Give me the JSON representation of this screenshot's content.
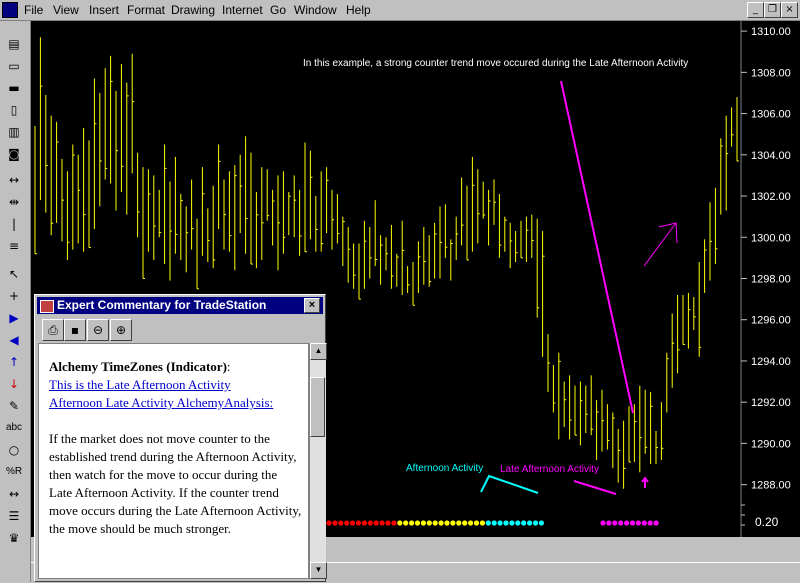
{
  "menu": {
    "items": [
      "File",
      "View",
      "Insert",
      "Format",
      "Drawing",
      "Internet",
      "Go",
      "Window",
      "Help"
    ]
  },
  "window_controls": {
    "minimize": "_",
    "restore": "❐",
    "close": "×"
  },
  "toolbar": {
    "icons": [
      "print-icon",
      "open-folder-icon",
      "save-folder-icon",
      "new-document-icon",
      "chart-icon",
      "strategy-icon",
      "expand-icon",
      "compress-icon",
      "vertical-line-icon",
      "horizontal-lines-icon",
      "pointer-icon",
      "crosshair-icon",
      "goto-end-icon",
      "goto-start-icon",
      "arrow-up-icon",
      "arrow-down-icon",
      "pencil-icon",
      "text-icon",
      "ellipse-icon",
      "percent-r-icon",
      "double-arrow-icon",
      "list-icon",
      "trophy-icon"
    ],
    "text_tool": "abc",
    "percent_tool": "%R"
  },
  "chart_data": {
    "type": "bar",
    "annotation_main": "In this example, a strong counter trend move occured during the Late Afternoon Activity",
    "label_afternoon": "Afternoon Activity",
    "label_late_afternoon": "Late Afternoon Activity",
    "y_ticks": [
      "1310.00",
      "1308.00",
      "1306.00",
      "1304.00",
      "1302.00",
      "1300.00",
      "1298.00",
      "1296.00",
      "1294.00",
      "1292.00",
      "1290.00",
      "1288.00"
    ],
    "y_tick_values": [
      1310,
      1308,
      1306,
      1304,
      1302,
      1300,
      1298,
      1296,
      1294,
      1292,
      1290,
      1288
    ],
    "ylim": [
      1287.4,
      1310.2
    ],
    "indicator_value": "0.20",
    "colors": {
      "price_bars": "#ffff00",
      "annotation": "#ff00ff",
      "afternoon": "#00ffff",
      "dot_red": "#ff0000",
      "dot_yellow": "#ffff00",
      "dot_cyan": "#00ffff",
      "dot_magenta": "#ff00ff"
    },
    "indicator_dots": {
      "red": 12,
      "yellow": 15,
      "cyan": 10,
      "magenta": 10
    },
    "price_bars": [
      [
        1305.4,
        1299.2
      ],
      [
        1309.7,
        1301.8
      ],
      [
        1306.9,
        1301.2
      ],
      [
        1305.9,
        1300.1
      ],
      [
        1305.6,
        1300.7
      ],
      [
        1303.8,
        1299.8
      ],
      [
        1303.2,
        1298.9
      ],
      [
        1304.5,
        1299.4
      ],
      [
        1304.0,
        1299.7
      ],
      [
        1305.3,
        1299.3
      ],
      [
        1304.7,
        1299.5
      ],
      [
        1307.7,
        1300.4
      ],
      [
        1307.0,
        1301.5
      ],
      [
        1308.2,
        1302.8
      ],
      [
        1308.8,
        1302.6
      ],
      [
        1307.1,
        1301.3
      ],
      [
        1308.4,
        1302.2
      ],
      [
        1307.5,
        1301.1
      ],
      [
        1308.9,
        1303.1
      ],
      [
        1304.1,
        1300.0
      ],
      [
        1303.4,
        1298.0
      ],
      [
        1303.3,
        1299.3
      ],
      [
        1303.0,
        1298.9
      ],
      [
        1302.3,
        1300.0
      ],
      [
        1304.5,
        1298.7
      ],
      [
        1302.7,
        1297.9
      ],
      [
        1303.9,
        1299.2
      ],
      [
        1302.1,
        1298.9
      ],
      [
        1301.5,
        1298.3
      ],
      [
        1302.8,
        1299.4
      ],
      [
        1300.9,
        1297.5
      ],
      [
        1303.4,
        1299.1
      ],
      [
        1301.4,
        1298.8
      ],
      [
        1302.5,
        1298.5
      ],
      [
        1304.5,
        1300.4
      ],
      [
        1302.8,
        1299.4
      ],
      [
        1303.2,
        1299.3
      ],
      [
        1303.5,
        1298.4
      ],
      [
        1304.0,
        1300.2
      ],
      [
        1304.9,
        1299.2
      ],
      [
        1304.1,
        1298.7
      ],
      [
        1302.2,
        1298.5
      ],
      [
        1303.4,
        1298.9
      ],
      [
        1303.3,
        1300.8
      ],
      [
        1302.3,
        1299.6
      ],
      [
        1303.0,
        1298.4
      ],
      [
        1303.2,
        1299.2
      ],
      [
        1302.2,
        1300.1
      ],
      [
        1303.0,
        1300.0
      ],
      [
        1302.3,
        1299.1
      ],
      [
        1304.6,
        1299.3
      ],
      [
        1304.2,
        1299.9
      ],
      [
        1302.0,
        1299.3
      ],
      [
        1303.2,
        1299.3
      ],
      [
        1303.4,
        1300.2
      ],
      [
        1302.3,
        1299.4
      ],
      [
        1302.1,
        1299.7
      ],
      [
        1301.0,
        1298.6
      ],
      [
        1300.5,
        1297.8
      ],
      [
        1299.7,
        1297.5
      ],
      [
        1299.7,
        1297.0
      ],
      [
        1300.8,
        1297.5
      ],
      [
        1300.5,
        1298.0
      ],
      [
        1301.8,
        1298.6
      ],
      [
        1300.1,
        1297.7
      ],
      [
        1300.0,
        1298.4
      ],
      [
        1300.6,
        1297.5
      ],
      [
        1299.2,
        1297.6
      ],
      [
        1300.8,
        1297.2
      ],
      [
        1298.6,
        1297.3
      ],
      [
        1298.8,
        1296.7
      ],
      [
        1299.8,
        1297.3
      ],
      [
        1300.5,
        1297.7
      ],
      [
        1300.1,
        1297.6
      ],
      [
        1300.7,
        1298.0
      ],
      [
        1301.5,
        1298.0
      ],
      [
        1301.6,
        1299.0
      ],
      [
        1299.9,
        1297.9
      ],
      [
        1301.0,
        1298.9
      ],
      [
        1302.9,
        1299.6
      ],
      [
        1302.5,
        1298.9
      ],
      [
        1303.9,
        1299.3
      ],
      [
        1303.3,
        1299.7
      ],
      [
        1302.7,
        1300.9
      ],
      [
        1302.3,
        1299.6
      ],
      [
        1302.8,
        1300.6
      ],
      [
        1302.1,
        1299.0
      ],
      [
        1301.0,
        1299.3
      ],
      [
        1300.7,
        1298.5
      ],
      [
        1300.3,
        1298.8
      ],
      [
        1300.8,
        1299.0
      ],
      [
        1301.0,
        1298.8
      ],
      [
        1301.1,
        1299.0
      ],
      [
        1300.9,
        1296.1
      ],
      [
        1300.3,
        1294.2
      ],
      [
        1295.3,
        1292.5
      ],
      [
        1293.8,
        1291.5
      ],
      [
        1294.4,
        1290.2
      ],
      [
        1293.0,
        1290.8
      ],
      [
        1293.3,
        1290.2
      ],
      [
        1292.8,
        1290.4
      ],
      [
        1293.0,
        1289.9
      ],
      [
        1292.8,
        1290.5
      ],
      [
        1293.3,
        1290.4
      ],
      [
        1292.1,
        1289.2
      ],
      [
        1292.6,
        1289.6
      ],
      [
        1291.9,
        1289.7
      ],
      [
        1291.5,
        1288.8
      ],
      [
        1290.7,
        1288.1
      ],
      [
        1291.1,
        1287.8
      ],
      [
        1291.8,
        1289.1
      ],
      [
        1291.9,
        1289.1
      ],
      [
        1292.8,
        1288.6
      ],
      [
        1292.6,
        1289.5
      ],
      [
        1292.5,
        1289.0
      ],
      [
        1290.6,
        1289.0
      ],
      [
        1292.0,
        1289.2
      ],
      [
        1294.4,
        1291.5
      ],
      [
        1296.3,
        1292.7
      ],
      [
        1297.2,
        1293.4
      ],
      [
        1297.2,
        1294.8
      ],
      [
        1297.3,
        1294.6
      ],
      [
        1297.1,
        1295.5
      ],
      [
        1298.8,
        1294.2
      ],
      [
        1299.9,
        1297.3
      ],
      [
        1301.7,
        1297.9
      ],
      [
        1302.4,
        1298.7
      ],
      [
        1304.8,
        1301.1
      ],
      [
        1305.9,
        1301.3
      ],
      [
        1306.3,
        1304.4
      ],
      [
        1306.8,
        1303.7
      ]
    ]
  },
  "commentary": {
    "title": "Expert Commentary for TradeStation",
    "close": "×",
    "heading": "Alchemy TimeZones (Indicator)",
    "heading_suffix": ":",
    "link1": "This is the Late Afternoon Activity",
    "link2": "Afternoon Late Activity AlchemyAnalysis:",
    "paragraph": "If the market does not move counter to the established trend during the Afternoon Activity, then watch for the move to occur during the Late Afternoon Activity. If the counter trend move occurs during the Late Afternoon Activity, the move should be much stronger.",
    "toolbar_icons": [
      "print-icon",
      "save-icon",
      "zoom-out-icon",
      "zoom-in-icon"
    ],
    "glyphs": {
      "print": "⎙",
      "save": "▪",
      "zoom_out": "⊖",
      "zoom_in": "⊕",
      "scroll_up": "▲",
      "scroll_down": "▼"
    }
  }
}
